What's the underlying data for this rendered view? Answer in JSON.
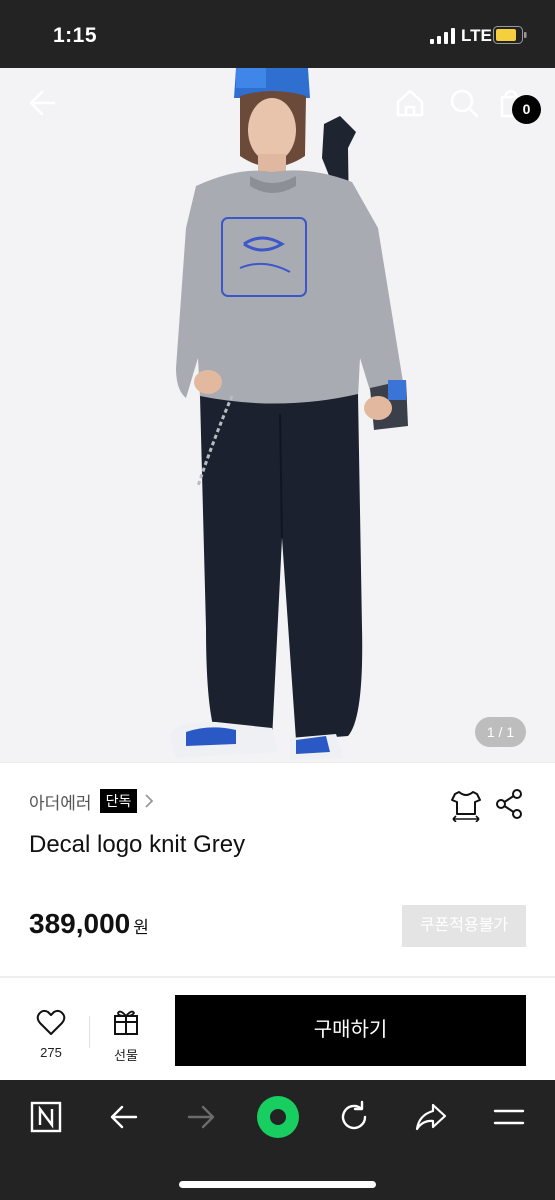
{
  "status_bar": {
    "time": "1:15",
    "network": "LTE"
  },
  "header": {
    "back_icon": "back-arrow-icon",
    "home_icon": "home-icon",
    "search_icon": "search-icon",
    "cart_icon": "shopping-bag-icon",
    "cart_count": "0"
  },
  "gallery": {
    "counter": "1 / 1"
  },
  "product": {
    "brand": "아더에러",
    "exclusive_badge": "단독",
    "name": "Decal logo knit Grey",
    "price": "389,000",
    "currency": "원",
    "coupon_label": "쿠폰적용불가"
  },
  "actions": {
    "like_count": "275",
    "gift_label": "선물",
    "buy_label": "구매하기"
  },
  "browser_toolbar": {
    "items": [
      "naver-n-icon",
      "back-arrow-icon",
      "forward-arrow-icon",
      "green-home-dot-icon",
      "refresh-icon",
      "share-arrow-icon",
      "menu-icon"
    ]
  },
  "colors": {
    "accent_green": "#19ce60",
    "buy_button": "#000000",
    "coupon_disabled": "#e4e4e4"
  }
}
